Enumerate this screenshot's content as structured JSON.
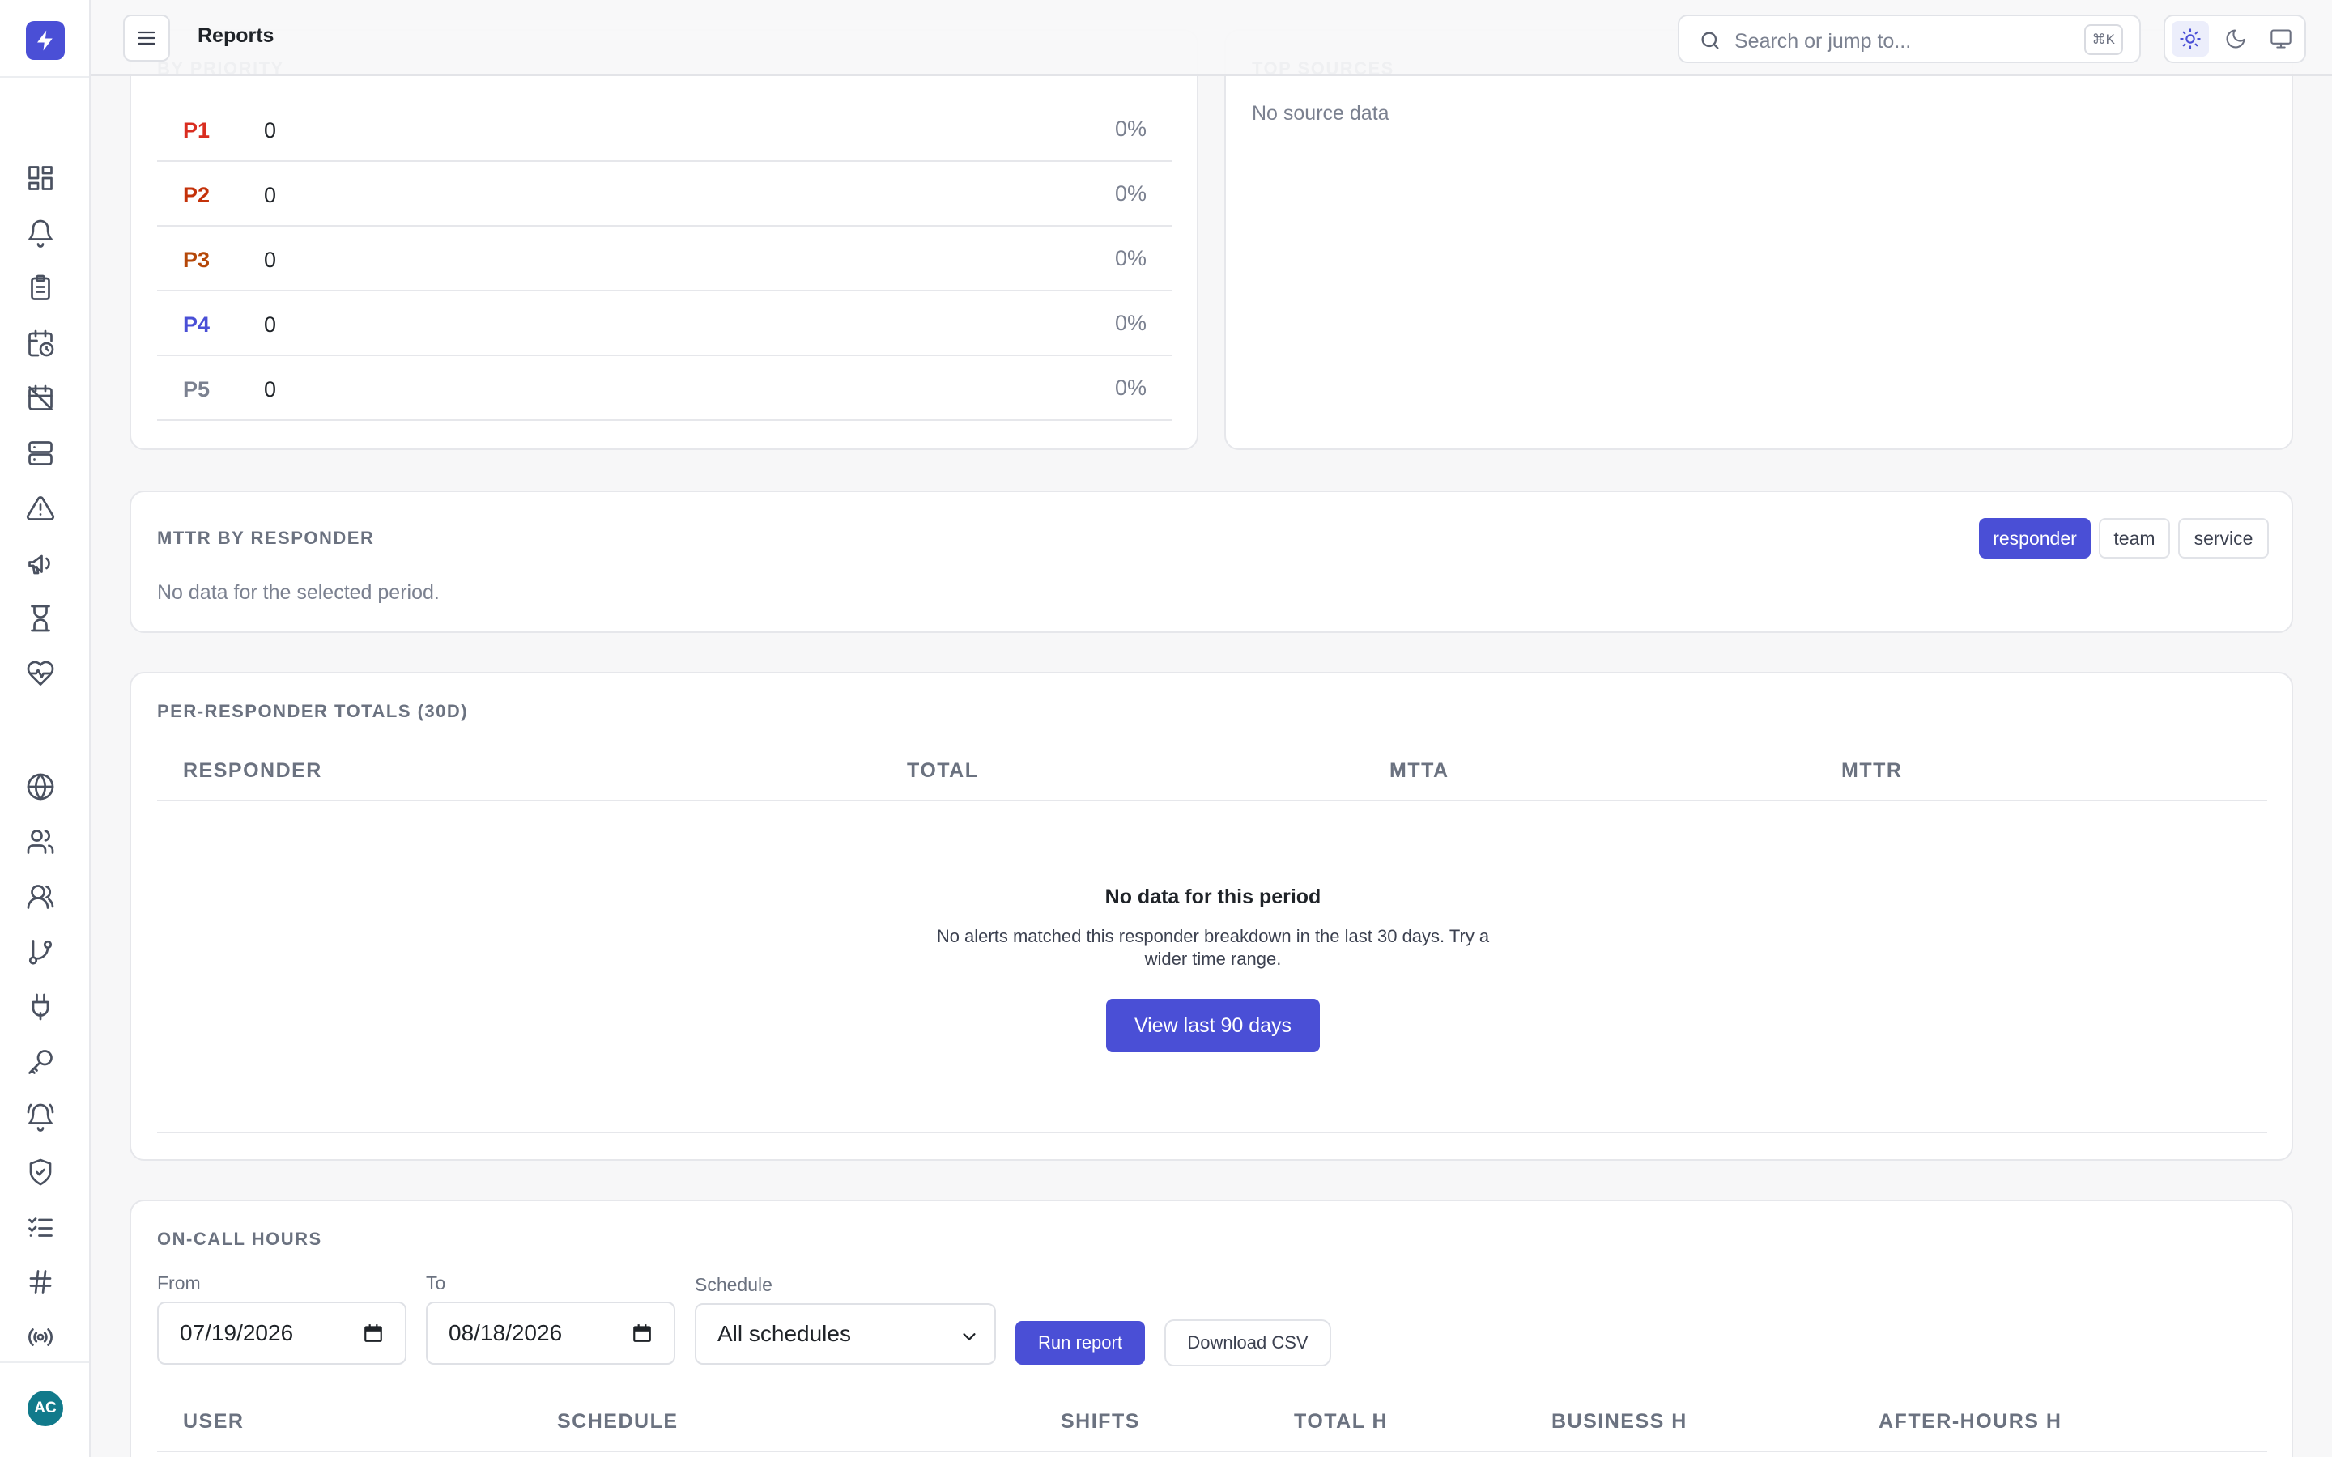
{
  "app": {
    "logo_icon": "bolt-icon",
    "accent": "#4a4fd6"
  },
  "header": {
    "title": "Reports",
    "search_placeholder": "Search or jump to...",
    "search_shortcut": "⌘K",
    "theme_options": [
      "light-icon",
      "dark-icon",
      "system-icon"
    ],
    "theme_active": "light"
  },
  "sidebar": {
    "items": [
      {
        "icon": "dashboard-icon"
      },
      {
        "icon": "bell-icon"
      },
      {
        "icon": "clipboard-icon"
      },
      {
        "icon": "calendar-clock-icon"
      },
      {
        "icon": "calendar-off-icon"
      },
      {
        "icon": "server-icon"
      },
      {
        "icon": "alert-triangle-icon"
      },
      {
        "icon": "megaphone-icon"
      },
      {
        "icon": "hourglass-icon"
      },
      {
        "icon": "heart-pulse-icon"
      },
      {
        "icon": "globe-icon"
      },
      {
        "icon": "users-icon"
      },
      {
        "icon": "team-icon"
      },
      {
        "icon": "git-branch-icon"
      },
      {
        "icon": "plug-icon"
      },
      {
        "icon": "key-icon"
      },
      {
        "icon": "bell-ring-icon"
      },
      {
        "icon": "shield-check-icon"
      },
      {
        "icon": "list-checks-icon"
      },
      {
        "icon": "hash-icon"
      },
      {
        "icon": "broadcast-icon"
      }
    ],
    "user_initials": "AC"
  },
  "by_priority": {
    "label": "BY PRIORITY",
    "rows": [
      {
        "priority": "P1",
        "count": "0",
        "pct": "0%",
        "color": "#d92d20"
      },
      {
        "priority": "P2",
        "count": "0",
        "pct": "0%",
        "color": "#c4320a"
      },
      {
        "priority": "P3",
        "count": "0",
        "pct": "0%",
        "color": "#b54708"
      },
      {
        "priority": "P4",
        "count": "0",
        "pct": "0%",
        "color": "#4a4fd6"
      },
      {
        "priority": "P5",
        "count": "0",
        "pct": "0%",
        "color": "#7b8190"
      }
    ]
  },
  "top_sources": {
    "label": "TOP SOURCES",
    "empty": "No source data"
  },
  "mttr": {
    "label": "MTTR BY RESPONDER",
    "empty": "No data for the selected period.",
    "groupings": [
      "responder",
      "team",
      "service"
    ],
    "active": "responder"
  },
  "per_responder": {
    "label": "PER-RESPONDER TOTALS (30D)",
    "columns": [
      "RESPONDER",
      "TOTAL",
      "MTTA",
      "MTTR"
    ],
    "empty_title": "No data for this period",
    "empty_line1": "No alerts matched this responder breakdown in the last 30 days. Try a",
    "empty_line2": "wider time range.",
    "action": "View last 90 days"
  },
  "on_call": {
    "label": "ON-CALL HOURS",
    "from_label": "From",
    "from_value": "07/19/2026",
    "to_label": "To",
    "to_value": "08/18/2026",
    "schedule_label": "Schedule",
    "schedule_value": "All schedules",
    "run": "Run report",
    "download": "Download CSV",
    "columns": [
      "USER",
      "SCHEDULE",
      "SHIFTS",
      "TOTAL H",
      "BUSINESS H",
      "AFTER-HOURS H"
    ]
  }
}
